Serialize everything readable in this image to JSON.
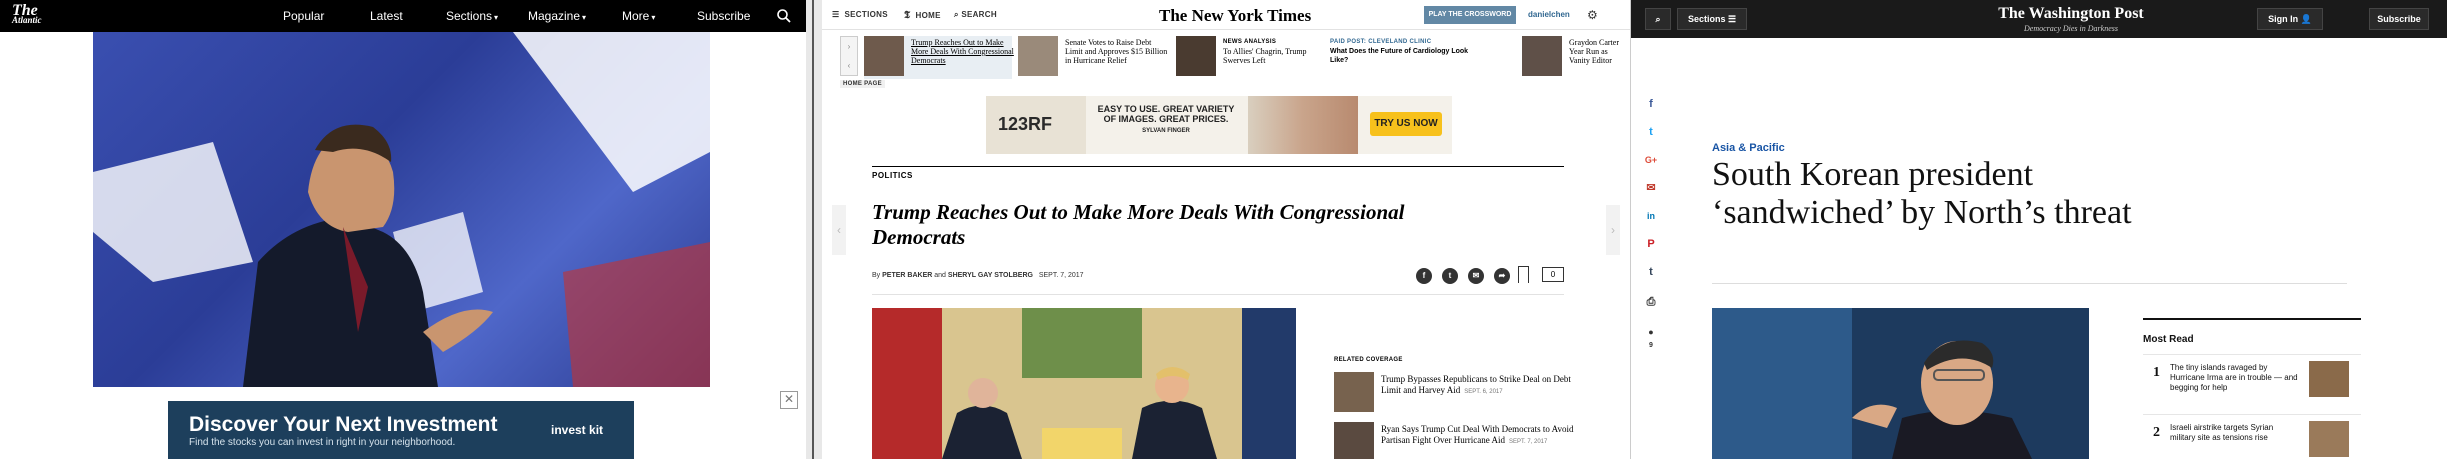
{
  "atlantic": {
    "logo": "The Atlantic",
    "nav": [
      {
        "label": "Popular",
        "caret": false
      },
      {
        "label": "Latest",
        "caret": false
      },
      {
        "label": "Sections",
        "caret": true
      },
      {
        "label": "Magazine",
        "caret": true
      },
      {
        "label": "More",
        "caret": true
      },
      {
        "label": "Subscribe",
        "caret": false
      }
    ],
    "ad": {
      "title": "Discover Your Next Investment",
      "subtitle": "Find the stocks you can invest in right in your neighborhood.",
      "brand": "invest kit"
    },
    "colors": {
      "nav_bg": "#000000",
      "ad_bg": "#1d3f5c",
      "hero_blue": "#3a4fb0"
    }
  },
  "nyt": {
    "toolbar": {
      "sections": "SECTIONS",
      "home": "HOME",
      "search": "SEARCH"
    },
    "masthead": "The New York Times",
    "crossword": "PLAY THE CROSSWORD",
    "user": "danielchen",
    "home_page_label": "HOME PAGE",
    "strip": [
      {
        "kicker": "",
        "text": "Trump Reaches Out to Make More Deals With Congressional Democrats",
        "selected": true
      },
      {
        "kicker": "",
        "text": "Senate Votes to Raise Debt Limit and Approves $15 Billion in Hurricane Relief",
        "selected": false
      },
      {
        "kicker": "NEWS ANALYSIS",
        "text": "To Allies' Chagrin, Trump Swerves Left",
        "selected": false
      },
      {
        "kicker": "PAID POST: CLEVELAND CLINIC",
        "text": "What Does the Future of Cardiology Look Like?",
        "selected": false
      },
      {
        "kicker": "",
        "text": "Graydon Carter Year Run as Vanity Editor",
        "selected": false
      }
    ],
    "ad": {
      "logo": "123RF",
      "copy": "EASY TO USE. GREAT VARIETY OF IMAGES. GREAT PRICES.",
      "credit": "SYLVAN FINGER",
      "cta": "TRY US NOW"
    },
    "section": "POLITICS",
    "headline": "Trump Reaches Out to Make More Deals With Congressional Democrats",
    "byline": {
      "prefix": "By",
      "authors_1": "PETER BAKER",
      "and": "and",
      "authors_2": "SHERYL GAY STOLBERG",
      "date": "SEPT. 7, 2017"
    },
    "comment_count": "0",
    "related_title": "RELATED COVERAGE",
    "related": [
      {
        "text": "Trump Bypasses Republicans to Strike Deal on Debt Limit and Harvey Aid",
        "date": "SEPT. 6, 2017"
      },
      {
        "text": "Ryan Says Trump Cut Deal With Democrats to Avoid Partisan Fight Over Hurricane Aid",
        "date": "SEPT. 7, 2017"
      }
    ],
    "colors": {
      "crossword_bg": "#6288a5",
      "link": "#326891"
    }
  },
  "wapo": {
    "sections": "Sections",
    "logo": "The Washington Post",
    "tagline": "Democracy Dies in Darkness",
    "signin": "Sign In",
    "subscribe": "Subscribe",
    "share_icons": [
      {
        "name": "facebook-icon",
        "glyph": "f",
        "color": "#3b5998"
      },
      {
        "name": "twitter-icon",
        "glyph": "t",
        "color": "#1da1f2"
      },
      {
        "name": "google-plus-icon",
        "glyph": "G+",
        "color": "#dd4b39"
      },
      {
        "name": "email-icon",
        "glyph": "✉",
        "color": "#c0392b"
      },
      {
        "name": "linkedin-icon",
        "glyph": "in",
        "color": "#0077b5"
      },
      {
        "name": "pinterest-icon",
        "glyph": "P",
        "color": "#cb2027"
      },
      {
        "name": "tumblr-icon",
        "glyph": "t",
        "color": "#35465c"
      },
      {
        "name": "print-icon",
        "glyph": "⎙",
        "color": "#333333"
      },
      {
        "name": "comments-icon",
        "glyph": "💬",
        "color": "#333333"
      }
    ],
    "comment_count": "9",
    "kicker": "Asia & Pacific",
    "headline": "South Korean president ‘sandwiched’ by North’s threat",
    "most_read_title": "Most Read",
    "most_read": [
      {
        "num": "1",
        "text": "The tiny islands ravaged by Hurricane Irma are in trouble — and begging for help"
      },
      {
        "num": "2",
        "text": "Israeli airstrike targets Syrian military site as tensions rise"
      }
    ],
    "colors": {
      "nav_bg": "#1a1a1a",
      "kicker": "#1955a5"
    }
  }
}
